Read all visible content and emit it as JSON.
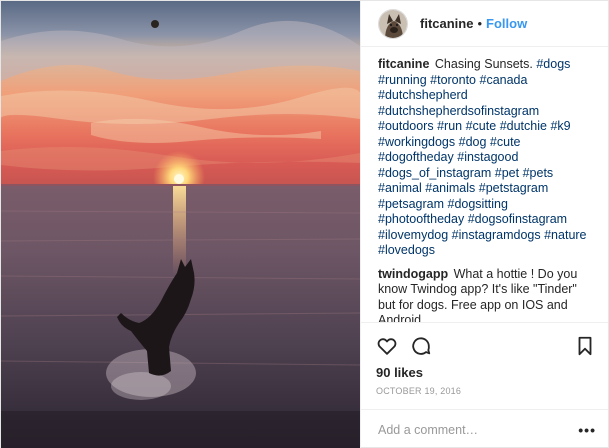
{
  "colors": {
    "accent": "#3897f0",
    "hashtag": "#003569",
    "text": "#262626",
    "muted": "#999999",
    "border": "#efefef"
  },
  "photo": {
    "alt": "Silhouette of a dog leaping into the water at sunset"
  },
  "header": {
    "username": "fitcanine",
    "separator": "•",
    "follow_label": "Follow",
    "avatar_icon": "dog-avatar"
  },
  "comments": [
    {
      "author": "fitcanine",
      "segments": [
        {
          "text": "Chasing Sunsets. ",
          "tag": false
        },
        {
          "text": "#dogs",
          "tag": true
        },
        {
          "text": " ",
          "tag": false
        },
        {
          "text": "#running",
          "tag": true
        },
        {
          "text": " ",
          "tag": false
        },
        {
          "text": "#toronto",
          "tag": true
        },
        {
          "text": " ",
          "tag": false
        },
        {
          "text": "#canada",
          "tag": true
        },
        {
          "text": " ",
          "tag": false
        },
        {
          "text": "#dutchshepherd",
          "tag": true
        },
        {
          "text": " ",
          "tag": false
        },
        {
          "text": "#dutchshepherdsofinstagram",
          "tag": true
        },
        {
          "text": " ",
          "tag": false
        },
        {
          "text": "#outdoors",
          "tag": true
        },
        {
          "text": " ",
          "tag": false
        },
        {
          "text": "#run",
          "tag": true
        },
        {
          "text": " ",
          "tag": false
        },
        {
          "text": "#cute",
          "tag": true
        },
        {
          "text": " ",
          "tag": false
        },
        {
          "text": "#dutchie",
          "tag": true
        },
        {
          "text": " ",
          "tag": false
        },
        {
          "text": "#k9",
          "tag": true
        },
        {
          "text": " ",
          "tag": false
        },
        {
          "text": "#workingdogs",
          "tag": true
        },
        {
          "text": " ",
          "tag": false
        },
        {
          "text": "#dog",
          "tag": true
        },
        {
          "text": " ",
          "tag": false
        },
        {
          "text": "#cute",
          "tag": true
        },
        {
          "text": " ",
          "tag": false
        },
        {
          "text": "#dogoftheday",
          "tag": true
        },
        {
          "text": " ",
          "tag": false
        },
        {
          "text": "#instagood",
          "tag": true
        },
        {
          "text": " ",
          "tag": false
        },
        {
          "text": "#dogs_of_instagram",
          "tag": true
        },
        {
          "text": " ",
          "tag": false
        },
        {
          "text": "#pet",
          "tag": true
        },
        {
          "text": " ",
          "tag": false
        },
        {
          "text": "#pets",
          "tag": true
        },
        {
          "text": " ",
          "tag": false
        },
        {
          "text": "#animal",
          "tag": true
        },
        {
          "text": " ",
          "tag": false
        },
        {
          "text": "#animals",
          "tag": true
        },
        {
          "text": " ",
          "tag": false
        },
        {
          "text": "#petstagram",
          "tag": true
        },
        {
          "text": " ",
          "tag": false
        },
        {
          "text": "#petsagram",
          "tag": true
        },
        {
          "text": " ",
          "tag": false
        },
        {
          "text": "#dogsitting",
          "tag": true
        },
        {
          "text": " ",
          "tag": false
        },
        {
          "text": "#photooftheday",
          "tag": true
        },
        {
          "text": " ",
          "tag": false
        },
        {
          "text": "#dogsofinstagram",
          "tag": true
        },
        {
          "text": " ",
          "tag": false
        },
        {
          "text": "#ilovemydog",
          "tag": true
        },
        {
          "text": " ",
          "tag": false
        },
        {
          "text": "#instagramdogs",
          "tag": true
        },
        {
          "text": " ",
          "tag": false
        },
        {
          "text": "#nature",
          "tag": true
        },
        {
          "text": " ",
          "tag": false
        },
        {
          "text": "#lovedogs",
          "tag": true
        }
      ]
    },
    {
      "author": "twindogapp",
      "segments": [
        {
          "text": "What a hottie ! Do you know Twindog app? It's like \"Tinder\" but for dogs. Free app on IOS and Android",
          "tag": false
        }
      ]
    }
  ],
  "actions": {
    "like_icon": "heart-icon",
    "comment_icon": "comment-icon",
    "save_icon": "bookmark-icon",
    "likes_text": "90 likes",
    "date_text": "OCTOBER 19, 2016"
  },
  "add_comment": {
    "placeholder": "Add a comment…",
    "more_label": "•••"
  }
}
